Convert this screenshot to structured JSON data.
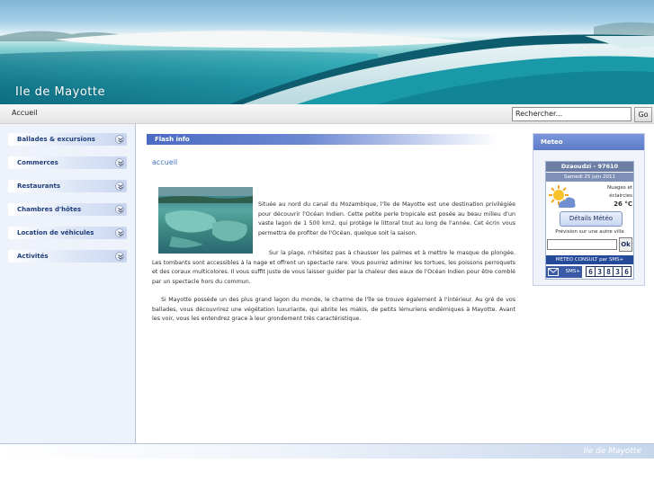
{
  "site": {
    "title": "Ile de Mayotte"
  },
  "navbar": {
    "breadcrumb": "Accueil",
    "search_value": "Rechercher...",
    "go_label": "Go"
  },
  "sidebar": {
    "items": [
      {
        "label": "Ballades & excursions",
        "icon": "chevron-down-icon"
      },
      {
        "label": "Commerces",
        "icon": "chevron-down-icon"
      },
      {
        "label": "Restaurants",
        "icon": "chevron-down-icon"
      },
      {
        "label": "Chambres d'hôtes",
        "icon": "chevron-down-icon"
      },
      {
        "label": "Location de véhicules",
        "icon": "chevron-down-icon"
      },
      {
        "label": "Activités",
        "icon": "chevron-down-icon"
      }
    ]
  },
  "main": {
    "flash_label": "Flash info",
    "heading": "accueil",
    "paragraphs": [
      "Située au nord du canal du Mozambique, l'île de Mayotte est une destination privilégiée pour découvrir l'Océan Indien. Cette petite perle tropicale est posée au beau milieu d'un vaste lagon de 1 500 km2, qui protège le littoral tout au long de l'année. Cet écrin vous permettra de profiter de l'Océan, quelque soit la saison.",
      "Sur la plage, n'hésitez pas à chausser les palmes et à mettre le masque de plongée. Les tombants sont accessibles à la nage et offrent un spectacle rare. Vous pourrez admirer les tortues, les poissons perroquets et des coraux multicolores. Il vous suffit juste de vous laisser guider par la chaleur des eaux de l'Océan Indien pour être comblé par un spectacle hors du commun.",
      "Si Mayotte possède un des plus grand lagon du monde, le charme de l'île se trouve également à l'intérieur. Au gré de vos ballades, vous découvrirez une végétation luxuriante, qui abrite les makis, de petits lémuriens endémiques à Mayotte. Avant les voir, vous les entendrez grace à leur grondement très caractéristique."
    ]
  },
  "meteo": {
    "title": "Meteo",
    "location": "Dzaoudzi - 97610",
    "date": "Samedi 25 juin 2011",
    "condition_line1": "Nuages et",
    "condition_line2": "éclaircies",
    "temperature": "26 °C",
    "details_button": "Détails Météo",
    "other_city_label": "Prévision sur une autre ville",
    "ok_label": "Ok",
    "consult_label": "METEO CONSULT par SMS+",
    "sms_label": "SMS+",
    "sms_digits": [
      "6",
      "3",
      "8",
      "3",
      "6"
    ],
    "icon": "sun-cloud-icon"
  },
  "footer": {
    "text": "Ile de Mayotte"
  }
}
